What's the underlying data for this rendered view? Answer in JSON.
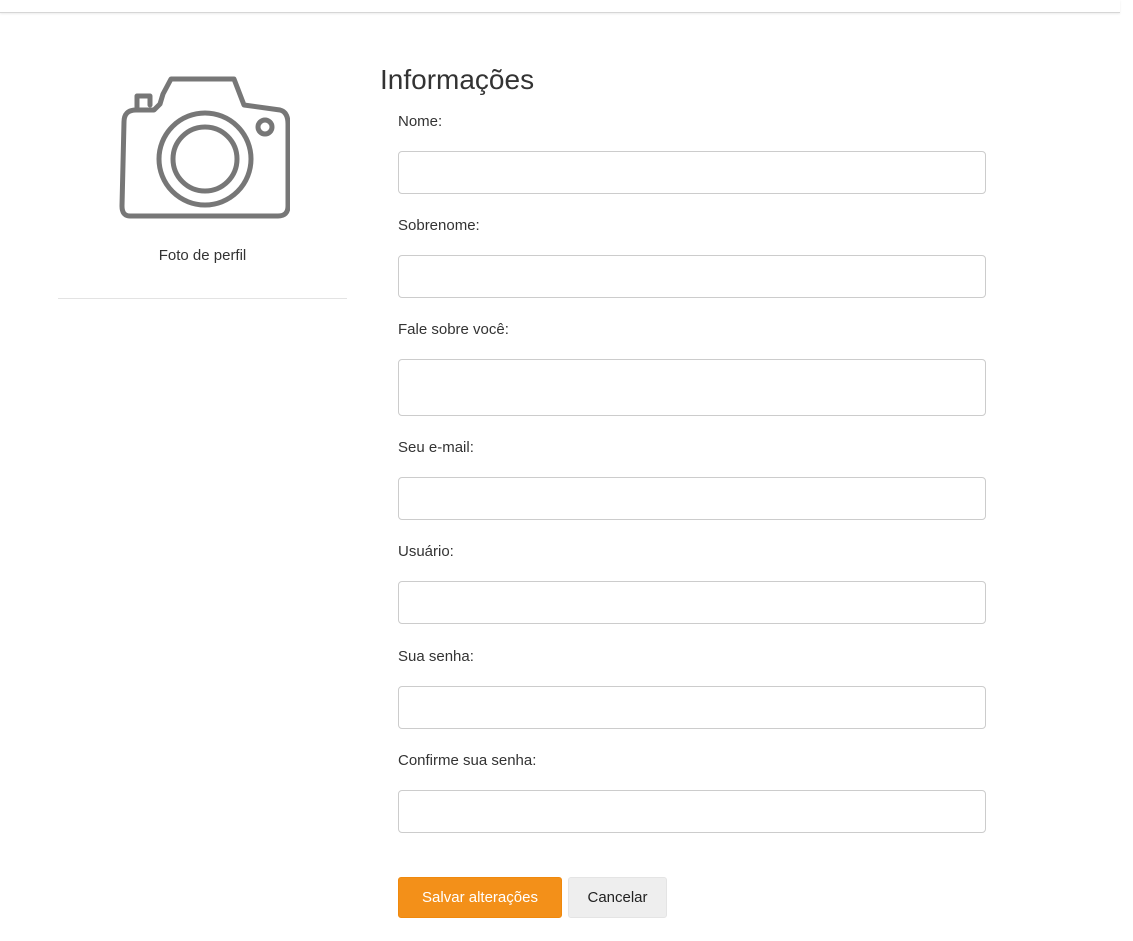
{
  "profile": {
    "photo_label": "Foto de perfil",
    "photo_icon": "camera-icon",
    "icon_color": "#777777"
  },
  "form": {
    "title": "Informações",
    "fields": {
      "nome": {
        "label": "Nome:",
        "value": ""
      },
      "sobrenome": {
        "label": "Sobrenome:",
        "value": ""
      },
      "sobre": {
        "label": "Fale sobre você:",
        "value": ""
      },
      "email": {
        "label": "Seu e-mail:",
        "value": ""
      },
      "usuario": {
        "label": "Usuário:",
        "value": ""
      },
      "senha": {
        "label": "Sua senha:",
        "value": ""
      },
      "confirma_senha": {
        "label": "Confirme sua senha:",
        "value": ""
      }
    }
  },
  "actions": {
    "save_label": "Salvar alterações",
    "cancel_label": "Cancelar",
    "accent_color": "#f39019"
  }
}
